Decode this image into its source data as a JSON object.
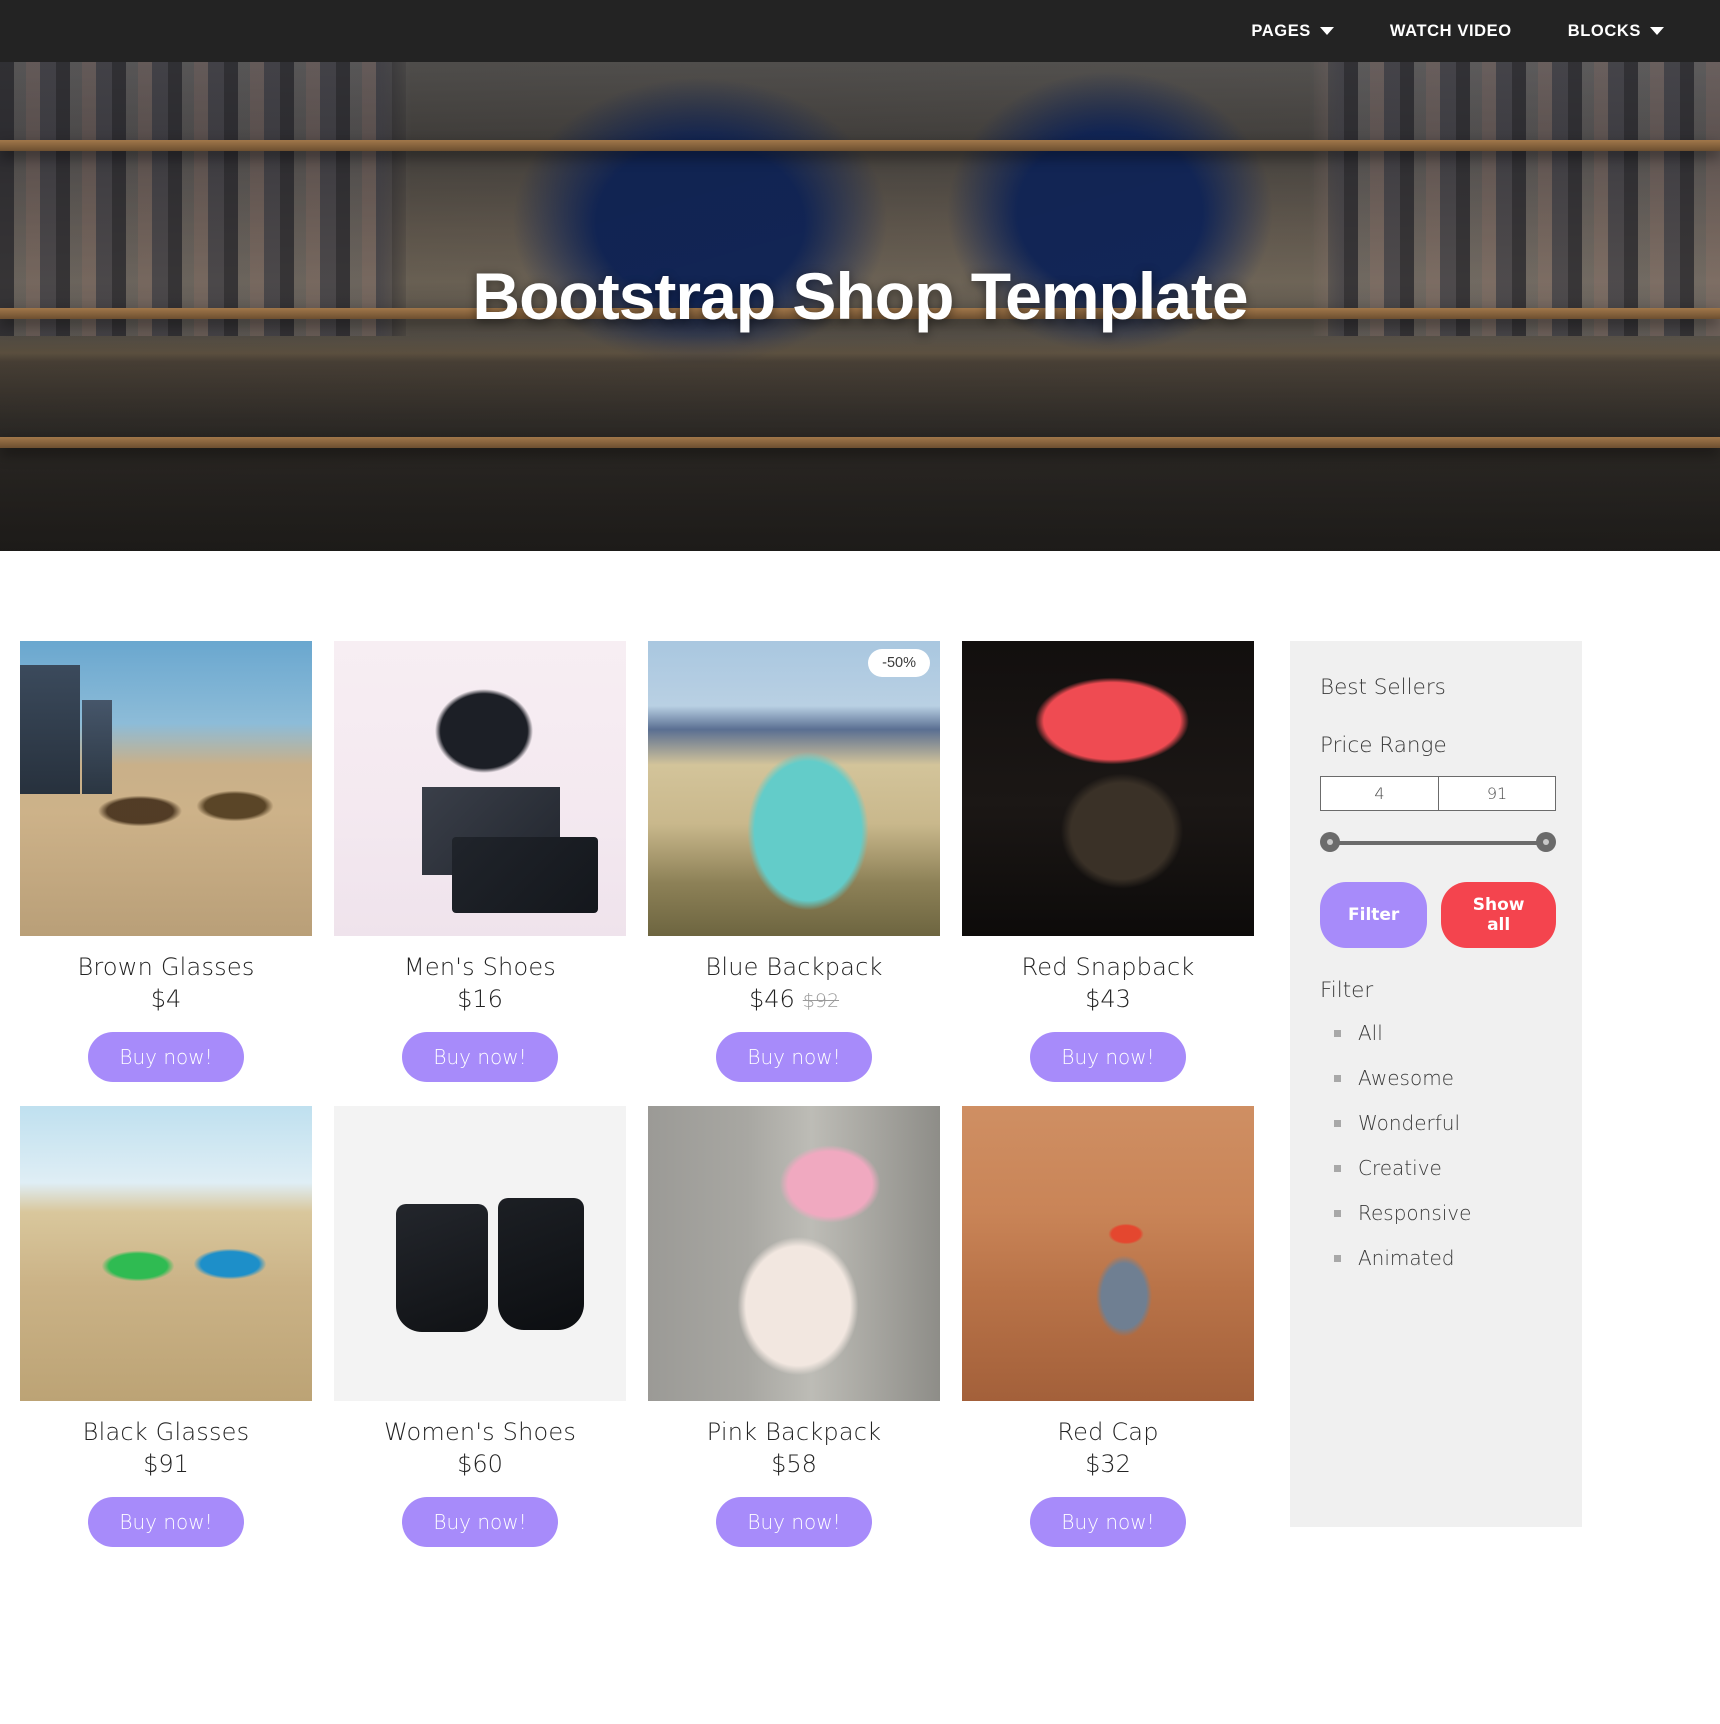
{
  "nav": {
    "items": [
      {
        "label": "PAGES",
        "has_caret": true,
        "icon": "chevron-down-icon"
      },
      {
        "label": "WATCH VIDEO",
        "has_caret": false,
        "icon": ""
      },
      {
        "label": "BLOCKS",
        "has_caret": true,
        "icon": "chevron-down-icon"
      }
    ]
  },
  "hero": {
    "title": "Bootstrap Shop Template"
  },
  "products": [
    {
      "name": "Brown Glasses",
      "price": "$4",
      "old_price": "",
      "badge": "",
      "button": "Buy now!",
      "photo": "p-brown-glasses"
    },
    {
      "name": "Men's Shoes",
      "price": "$16",
      "old_price": "",
      "badge": "",
      "button": "Buy now!",
      "photo": "p-mens-shoes"
    },
    {
      "name": "Blue Backpack",
      "price": "$46",
      "old_price": "$92",
      "badge": "-50%",
      "button": "Buy now!",
      "photo": "p-blue-backpack"
    },
    {
      "name": "Red Snapback",
      "price": "$43",
      "old_price": "",
      "badge": "",
      "button": "Buy now!",
      "photo": "p-red-snapback"
    },
    {
      "name": "Black Glasses",
      "price": "$91",
      "old_price": "",
      "badge": "",
      "button": "Buy now!",
      "photo": "p-black-glasses"
    },
    {
      "name": "Women's Shoes",
      "price": "$60",
      "old_price": "",
      "badge": "",
      "button": "Buy now!",
      "photo": "p-womens-shoes"
    },
    {
      "name": "Pink Backpack",
      "price": "$58",
      "old_price": "",
      "badge": "",
      "button": "Buy now!",
      "photo": "p-pink-backpack"
    },
    {
      "name": "Red Cap",
      "price": "$32",
      "old_price": "",
      "badge": "",
      "button": "Buy now!",
      "photo": "p-red-cap"
    }
  ],
  "sidebar": {
    "best_sellers_title": "Best Sellers",
    "price_range_title": "Price Range",
    "price_min": "4",
    "price_max": "91",
    "filter_button": "Filter",
    "show_all_button": "Show all",
    "filter_title": "Filter",
    "filter_items": [
      {
        "label": "All"
      },
      {
        "label": "Awesome"
      },
      {
        "label": "Wonderful"
      },
      {
        "label": "Creative"
      },
      {
        "label": "Responsive"
      },
      {
        "label": "Animated"
      }
    ]
  },
  "colors": {
    "navbar_bg": "#232323",
    "accent_purple": "#a78bfa",
    "accent_red": "#f4444e",
    "sidebar_bg": "#f0f0f0",
    "text_dark": "#232323"
  }
}
